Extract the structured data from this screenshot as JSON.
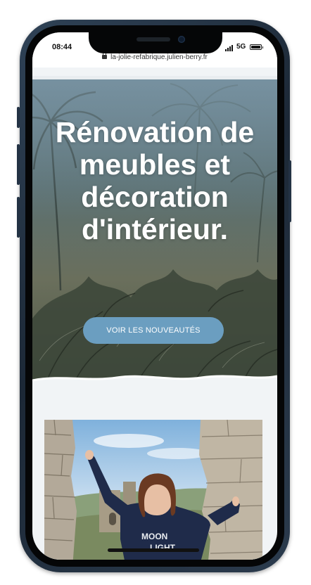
{
  "status_bar": {
    "time": "08:44",
    "network": "5G"
  },
  "browser": {
    "url": "la-jolie-refabrique.julien-berry.fr"
  },
  "hero": {
    "title": "Rénovation de meubles et décoration d'intérieur.",
    "cta_label": "VOIR LES NOUVEAUTÉS"
  },
  "colors": {
    "cta": "#6b9ec0",
    "hero_overlay": "#5b7072",
    "page_background": "#f1f4f6"
  }
}
